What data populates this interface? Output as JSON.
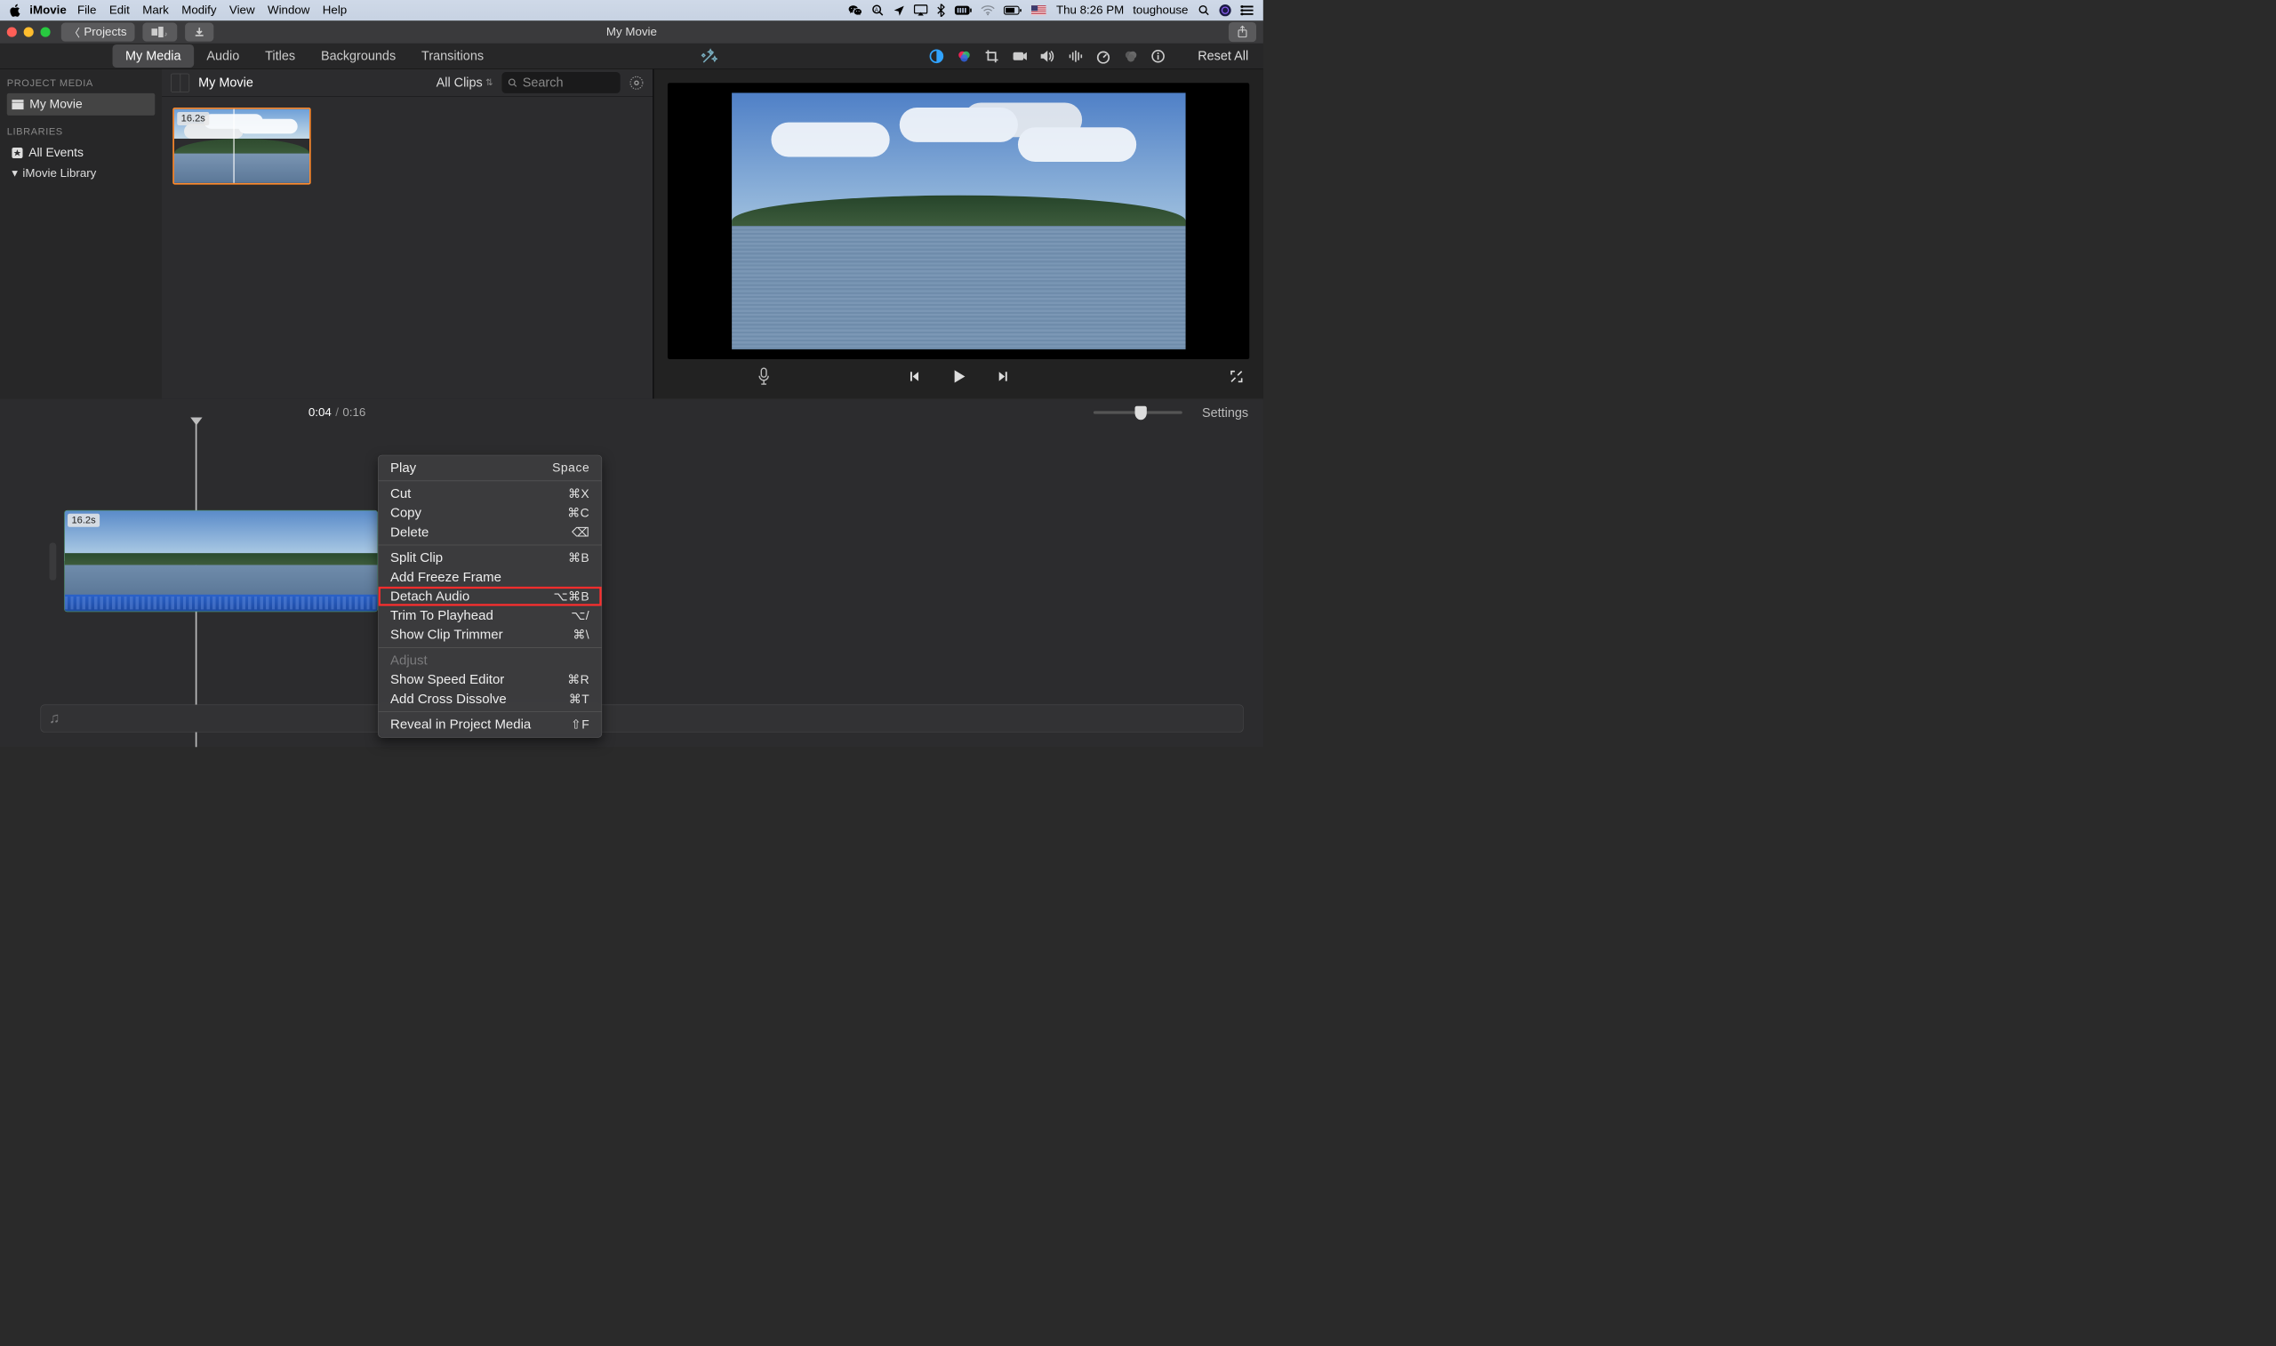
{
  "menuBar": {
    "appName": "iMovie",
    "items": [
      "File",
      "Edit",
      "Mark",
      "Modify",
      "View",
      "Window",
      "Help"
    ],
    "clock": "Thu 8:26 PM",
    "userName": "toughouse"
  },
  "titleBar": {
    "projectsBtn": "Projects",
    "windowTitle": "My Movie"
  },
  "tabs": {
    "items": [
      "My Media",
      "Audio",
      "Titles",
      "Backgrounds",
      "Transitions"
    ],
    "resetAll": "Reset All"
  },
  "sidebar": {
    "sec1": "PROJECT MEDIA",
    "projectItem": "My Movie",
    "sec2": "LIBRARIES",
    "allEvents": "All Events",
    "library": "iMovie Library"
  },
  "browser": {
    "title": "My Movie",
    "filterLabel": "All Clips",
    "searchPlaceholder": "Search",
    "clipDuration": "16.2s"
  },
  "timeline": {
    "current": "0:04",
    "total": "0:16",
    "settings": "Settings",
    "clipDuration": "16.2s"
  },
  "contextMenu": {
    "play": "Play",
    "play_sc": "Space",
    "cut": "Cut",
    "cut_sc": "⌘X",
    "copy": "Copy",
    "copy_sc": "⌘C",
    "delete": "Delete",
    "delete_sc": "⌫",
    "split": "Split Clip",
    "split_sc": "⌘B",
    "freeze": "Add Freeze Frame",
    "detach": "Detach Audio",
    "detach_sc": "⌥⌘B",
    "trim": "Trim To Playhead",
    "trim_sc": "⌥/",
    "trimmer": "Show Clip Trimmer",
    "trimmer_sc": "⌘\\",
    "adjust": "Adjust",
    "speed": "Show Speed Editor",
    "speed_sc": "⌘R",
    "cross": "Add Cross Dissolve",
    "cross_sc": "⌘T",
    "reveal": "Reveal in Project Media",
    "reveal_sc": "⇧F"
  }
}
